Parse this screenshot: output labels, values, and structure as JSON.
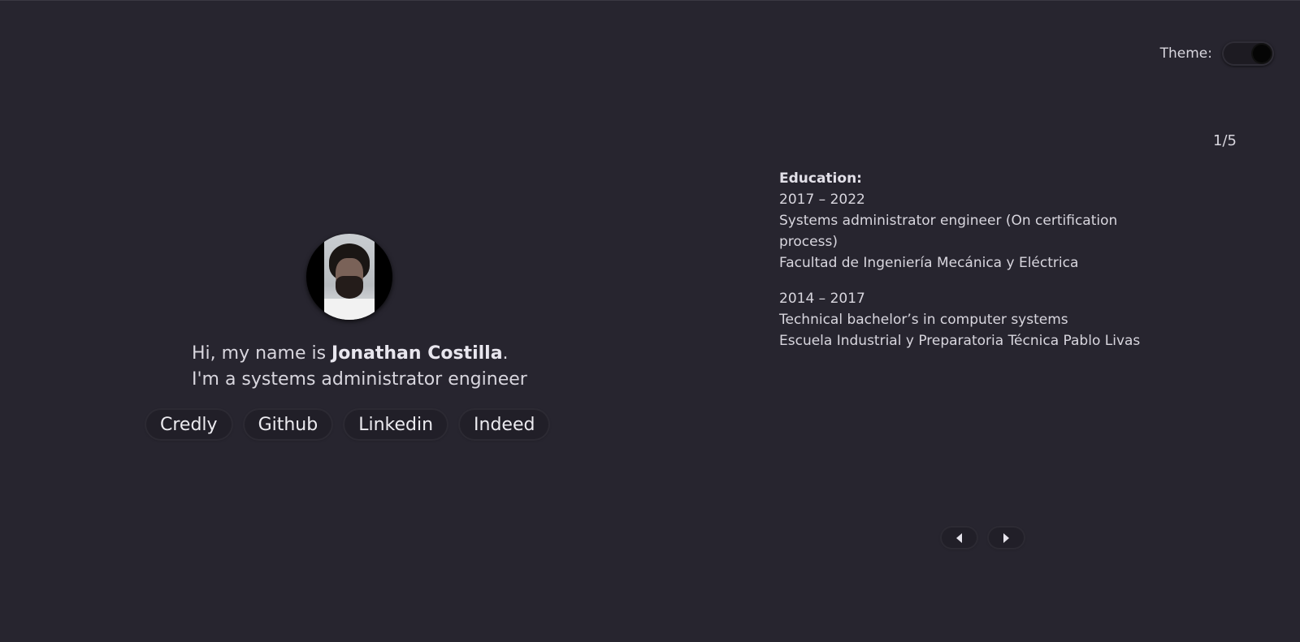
{
  "theme": {
    "label": "Theme:",
    "mode": "dark"
  },
  "profile": {
    "greeting_prefix": "Hi, my name is ",
    "name": "Jonathan Costilla",
    "greeting_suffix": ".",
    "tagline": "I'm a systems administrator engineer",
    "links": [
      {
        "label": "Credly"
      },
      {
        "label": "Github"
      },
      {
        "label": "Linkedin"
      },
      {
        "label": "Indeed"
      }
    ]
  },
  "carousel": {
    "counter": "1/5",
    "slide": {
      "title": "Education:",
      "entries": [
        {
          "years": "2017 – 2022",
          "degree": "Systems administrator engineer (On certification process)",
          "school": "Facultad de Ingeniería Mecánica y Eléctrica"
        },
        {
          "years": "2014 – 2017",
          "degree": "Technical bachelor’s in computer systems",
          "school": "Escuela Industrial y Preparatoria Técnica Pablo Livas"
        }
      ]
    }
  },
  "colors": {
    "background": "#27252f",
    "text": "#d8d6de",
    "button_bg": "#211f28"
  },
  "icons": {
    "prev": "triangle-left-icon",
    "next": "triangle-right-icon"
  }
}
